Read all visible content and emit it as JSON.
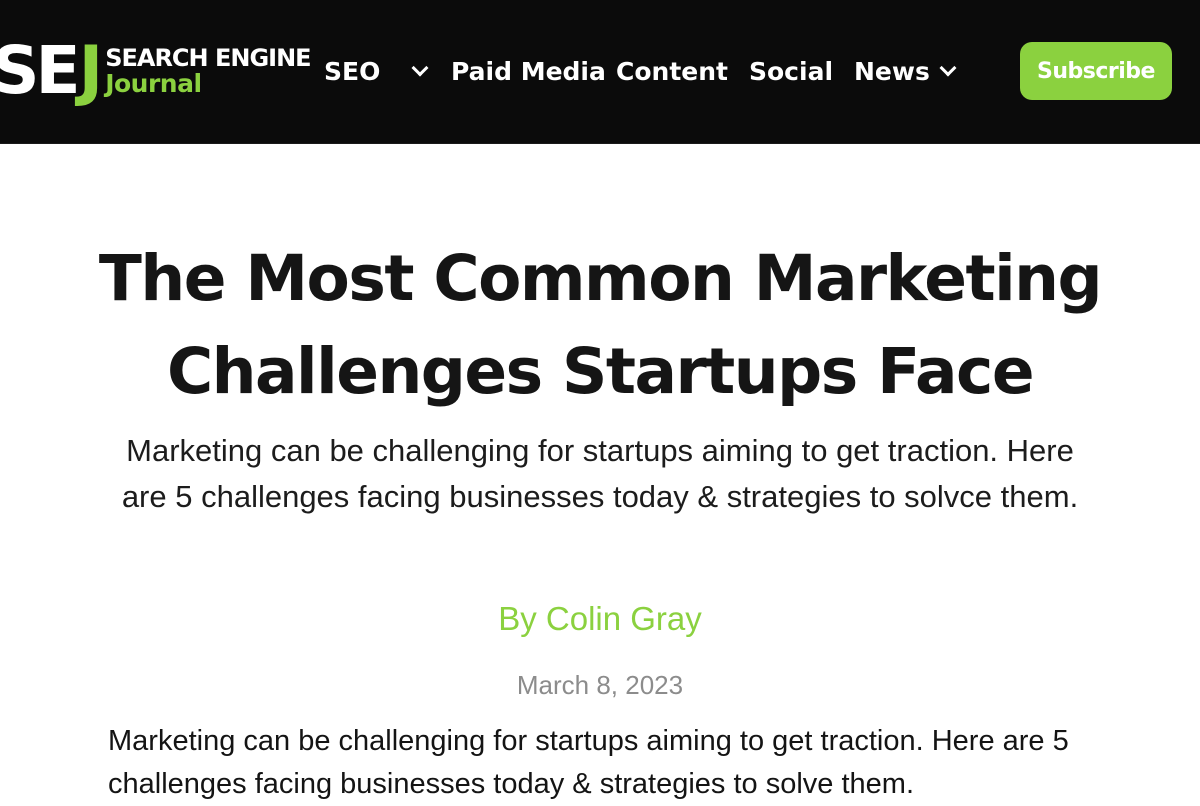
{
  "site": {
    "logo_mark": "SE",
    "logo_mark_j": "J",
    "logo_line1": "SEARCH ENGINE",
    "logo_line2": "Journal"
  },
  "nav": {
    "items": [
      {
        "label": "SEO",
        "has_dropdown": true
      },
      {
        "label": "Paid Media",
        "has_dropdown": false
      },
      {
        "label": "Content",
        "has_dropdown": false
      },
      {
        "label": "Social",
        "has_dropdown": false
      },
      {
        "label": "News",
        "has_dropdown": true
      }
    ],
    "subscribe_label": "Subscribe"
  },
  "article": {
    "title": "The Most Common Marketing Challenges Startups Face",
    "subtitle": "Marketing can be challenging for startups aiming to get traction. Here are 5 challenges facing businesses today & strategies to solvce them.",
    "author": "By Colin Gray",
    "date": "March 8, 2023",
    "body_intro": "Marketing can be challenging for startups aiming to get traction. Here are 5 challenges facing businesses today & strategies to solve them."
  },
  "colors": {
    "nav_background": "#0b0b0b",
    "accent_green": "#8bd13f",
    "title_text": "#151515",
    "date_text": "#8c8c8c"
  },
  "icons": {
    "dropdown": "chevron-down-icon"
  }
}
